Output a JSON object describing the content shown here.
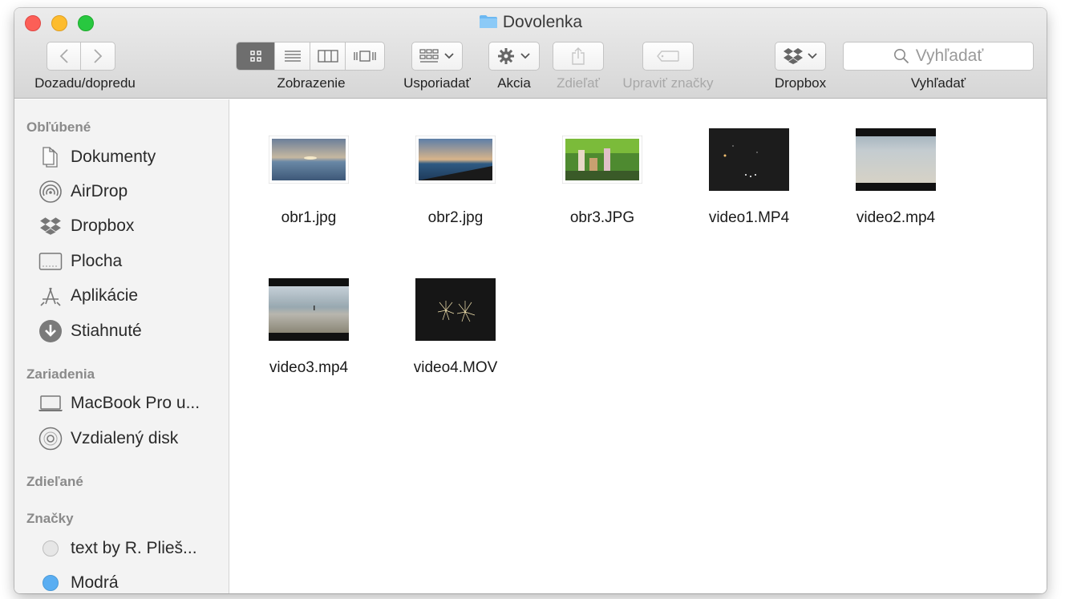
{
  "window": {
    "title": "Dovolenka"
  },
  "toolbar": {
    "nav_label": "Dozadu/dopredu",
    "view_label": "Zobrazenie",
    "arrange_label": "Usporiadať",
    "action_label": "Akcia",
    "share_label": "Zdieľať",
    "tags_label": "Upraviť značky",
    "dropbox_label": "Dropbox",
    "search_label": "Vyhľadať",
    "search_placeholder": "Vyhľadať"
  },
  "sidebar": {
    "favorites_header": "Obľúbené",
    "favorites": [
      {
        "label": "Dokumenty",
        "icon": "document-icon"
      },
      {
        "label": "AirDrop",
        "icon": "airdrop-icon"
      },
      {
        "label": "Dropbox",
        "icon": "dropbox-icon"
      },
      {
        "label": "Plocha",
        "icon": "desktop-icon"
      },
      {
        "label": "Aplikácie",
        "icon": "applications-icon"
      },
      {
        "label": "Stiahnuté",
        "icon": "downloads-icon"
      }
    ],
    "devices_header": "Zariadenia",
    "devices": [
      {
        "label": "MacBook Pro u...",
        "icon": "laptop-icon"
      },
      {
        "label": "Vzdialený disk",
        "icon": "disc-icon"
      }
    ],
    "shared_header": "Zdieľané",
    "tags_header": "Značky",
    "tags": [
      {
        "label": "text by R. Plieš...",
        "color": "#e6e6e6"
      },
      {
        "label": "Modrá",
        "color": "#5aaef2"
      }
    ]
  },
  "files": [
    {
      "name": "obr1.jpg",
      "kind": "photo"
    },
    {
      "name": "obr2.jpg",
      "kind": "photo"
    },
    {
      "name": "obr3.JPG",
      "kind": "photo"
    },
    {
      "name": "video1.MP4",
      "kind": "video"
    },
    {
      "name": "video2.mp4",
      "kind": "video"
    },
    {
      "name": "video3.mp4",
      "kind": "video"
    },
    {
      "name": "video4.MOV",
      "kind": "video"
    }
  ]
}
